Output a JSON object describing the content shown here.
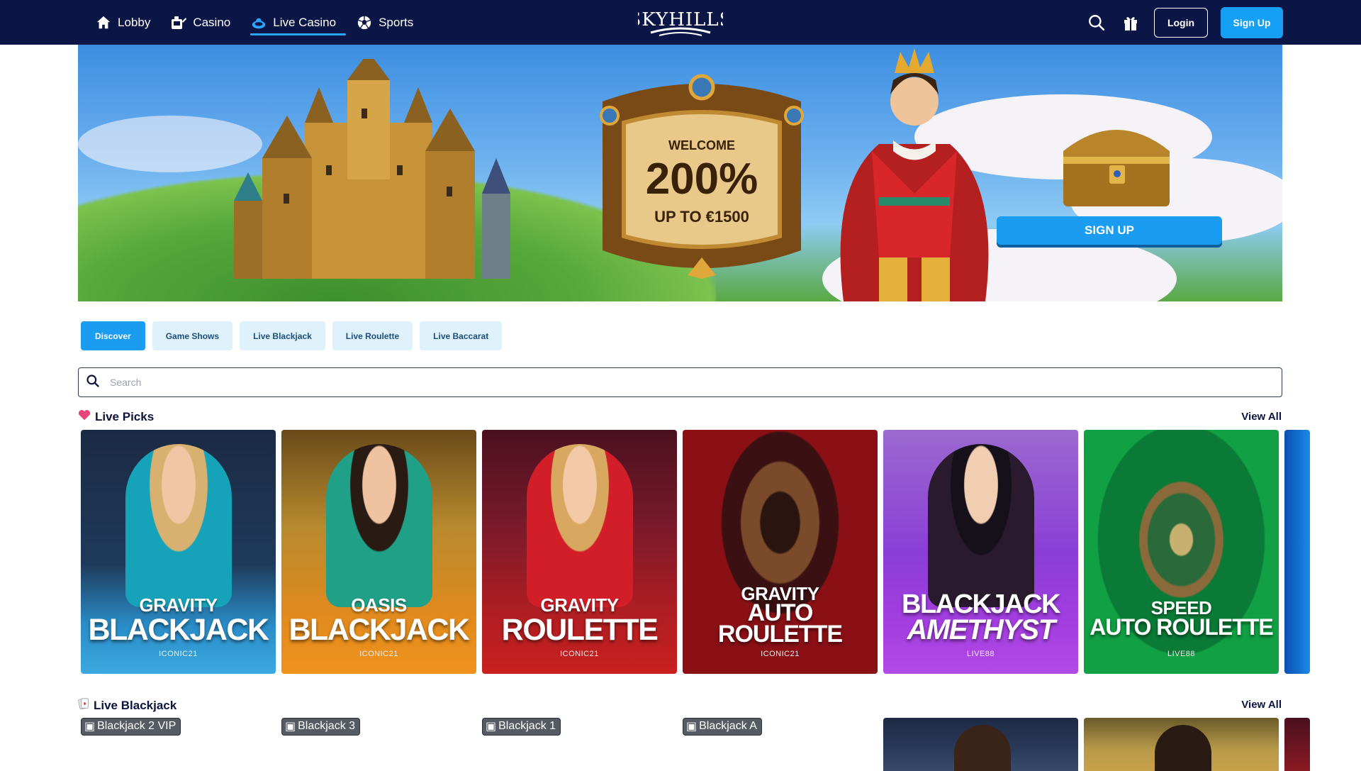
{
  "header": {
    "nav": [
      {
        "label": "Lobby",
        "icon": "home-icon"
      },
      {
        "label": "Casino",
        "icon": "slots-icon"
      },
      {
        "label": "Live Casino",
        "icon": "live-casino-icon",
        "active": true
      },
      {
        "label": "Sports",
        "icon": "soccer-ball-icon"
      }
    ],
    "logo_text": "SKYHILLS",
    "login_label": "Login",
    "signup_label": "Sign Up"
  },
  "banner": {
    "welcome": "WELCOME",
    "percent": "200%",
    "upto": "UP TO €1500",
    "cta": "SIGN UP"
  },
  "filters": [
    "Discover",
    "Game Shows",
    "Live Blackjack",
    "Live Roulette",
    "Live Baccarat"
  ],
  "search": {
    "placeholder": "Search"
  },
  "live_picks": {
    "title": "Live Picks",
    "view_all": "View All",
    "games": [
      {
        "line1": "GRAVITY",
        "line2": "BLACKJACK",
        "provider": "ICONIC21"
      },
      {
        "line1": "OASIS",
        "line2": "BLACKJACK",
        "provider": "ICONIC21"
      },
      {
        "line1": "GRAVITY",
        "line2": "ROULETTE",
        "provider": "ICONIC21"
      },
      {
        "line1": "GRAVITY",
        "line2": "AUTO",
        "line3": "ROULETTE",
        "provider": "ICONIC21"
      },
      {
        "line1": "BLACKJACK",
        "line2": "AMETHYST",
        "provider": "LIVE88"
      },
      {
        "line1": "SPEED",
        "line2": "AUTO ROULETTE",
        "provider": "LIVE88"
      }
    ]
  },
  "live_blackjack": {
    "title": "Live Blackjack",
    "view_all": "View All",
    "broken_images": [
      "Blackjack 2 VIP",
      "Blackjack 3",
      "Blackjack 1",
      "Blackjack A"
    ]
  },
  "colors": {
    "header_bg": "#0c1646",
    "accent": "#1a9cf0",
    "chip_bg": "#dff1fb"
  }
}
